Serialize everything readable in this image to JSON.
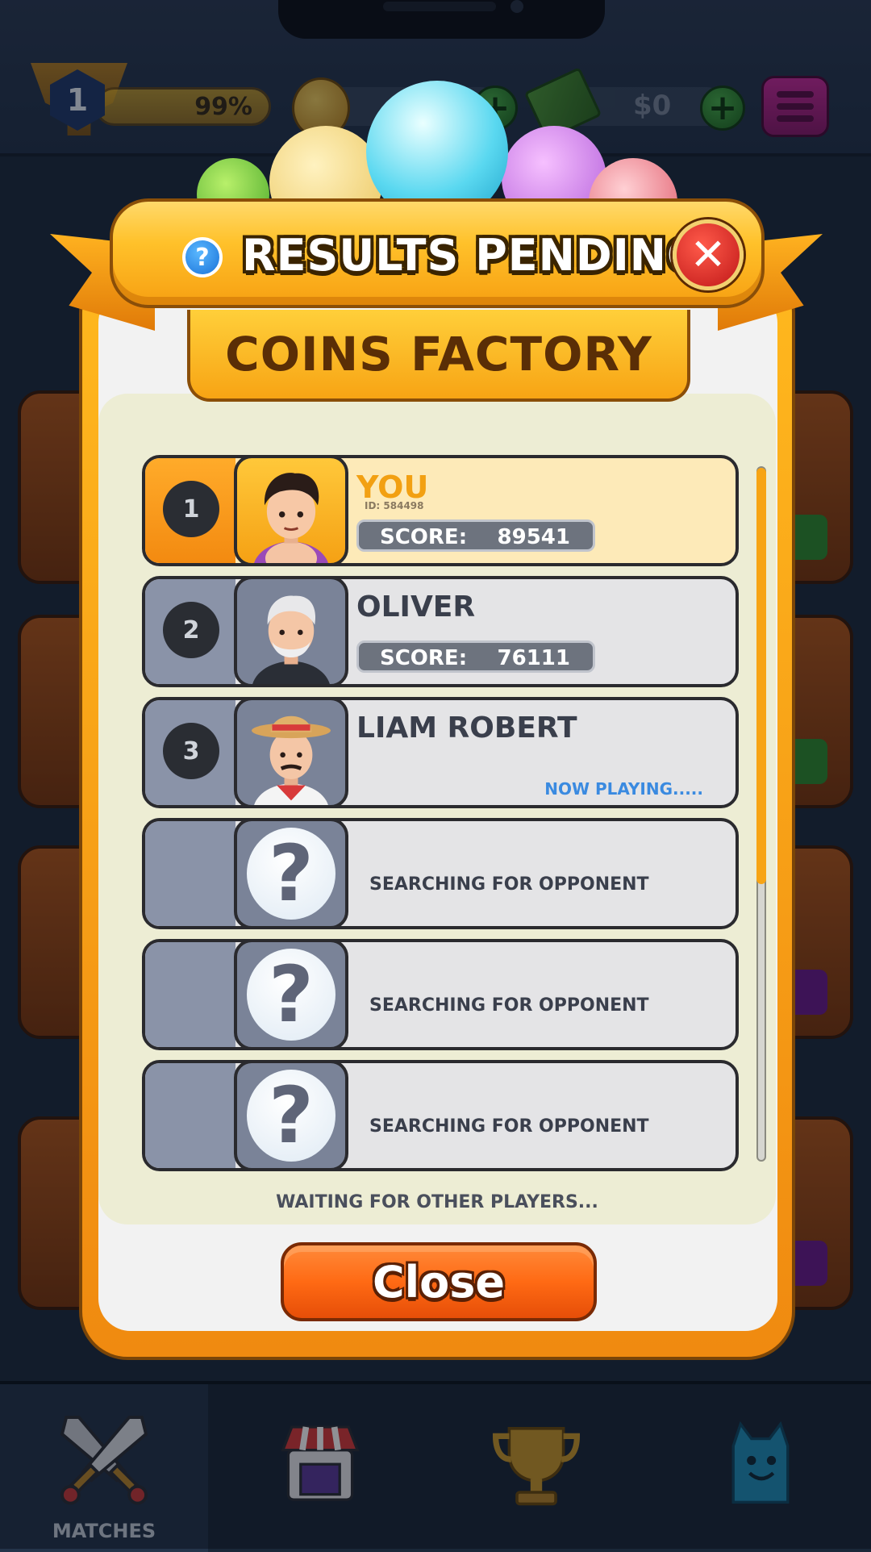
{
  "header": {
    "level": "1",
    "xp_percent_label": "99%",
    "cash_label": "$0",
    "add_label": "+"
  },
  "dialog": {
    "title": "RESULTS PENDING",
    "help_symbol": "?",
    "close_symbol": "✕",
    "subtitle": "COINS FACTORY",
    "players": [
      {
        "rank": "1",
        "name": "YOU",
        "id": "ID: 584498",
        "score_label": "SCORE:",
        "score": "89541",
        "status": ""
      },
      {
        "rank": "2",
        "name": "OLIVER",
        "id": "",
        "score_label": "SCORE:",
        "score": "76111",
        "status": ""
      },
      {
        "rank": "3",
        "name": "LIAM ROBERT",
        "id": "",
        "score_label": "",
        "score": "",
        "status": "NOW PLAYING....."
      }
    ],
    "placeholders": [
      {
        "symbol": "?",
        "text": "SEARCHING FOR OPPONENT"
      },
      {
        "symbol": "?",
        "text": "SEARCHING FOR OPPONENT"
      },
      {
        "symbol": "?",
        "text": "SEARCHING FOR OPPONENT"
      }
    ],
    "waiting_text": "WAITING FOR OTHER PLAYERS...",
    "close_button": "Close"
  },
  "nav": {
    "tabs": [
      {
        "label": "MATCHES",
        "icon": "crossed-swords-icon",
        "active": true
      },
      {
        "label": "",
        "icon": "shop-icon",
        "active": false
      },
      {
        "label": "",
        "icon": "trophy-icon",
        "active": false
      },
      {
        "label": "",
        "icon": "character-icon",
        "active": false
      }
    ]
  },
  "colors": {
    "accent_orange": "#f7a414",
    "close_button": "#ff6a14",
    "now_playing": "#3a8ae0",
    "panel_bg": "#ededd4"
  }
}
